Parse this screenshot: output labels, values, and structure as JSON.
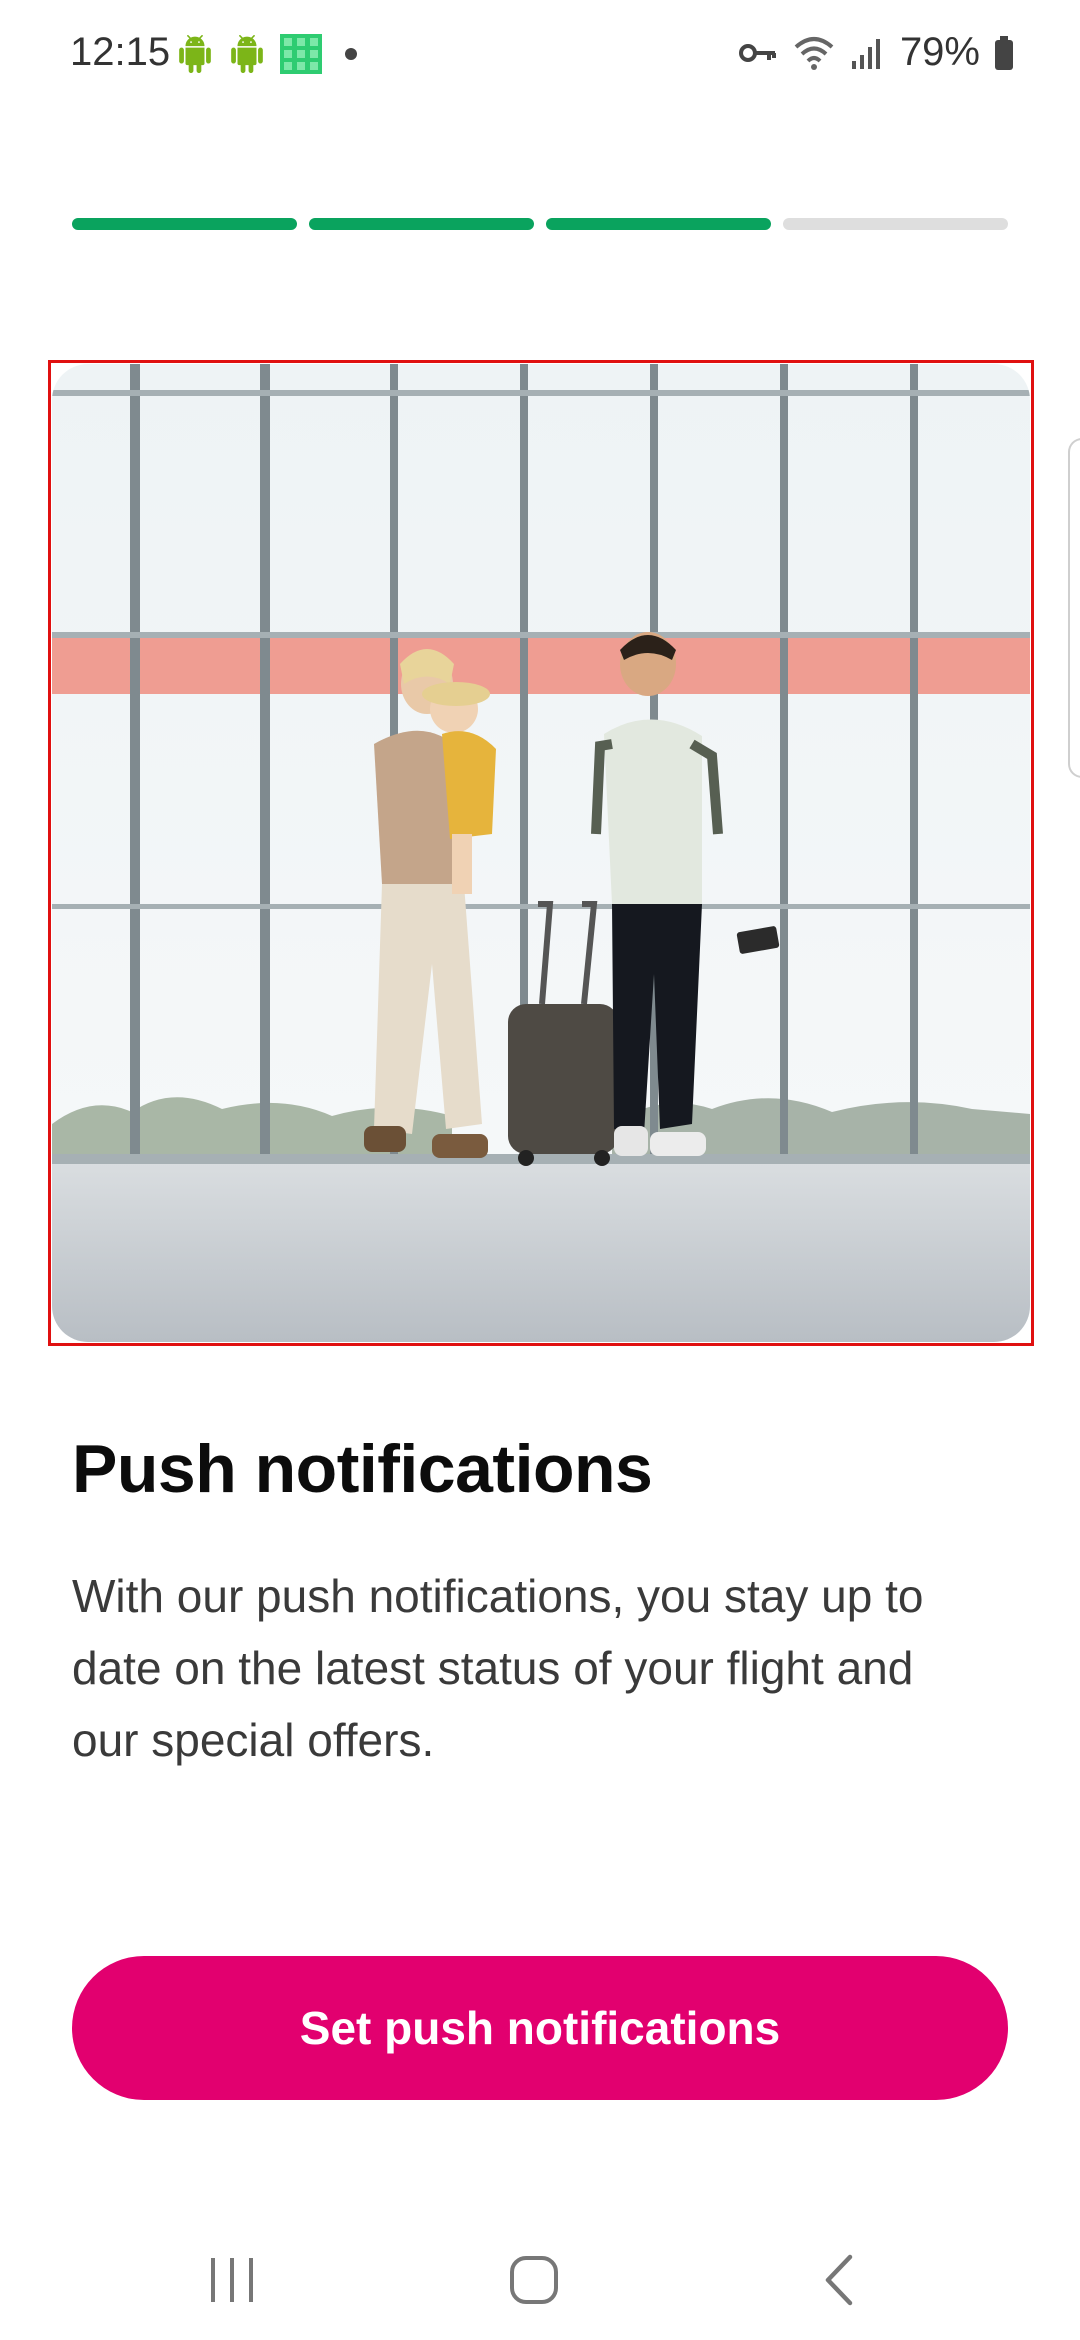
{
  "status_bar": {
    "time": "12:15",
    "battery": "79%",
    "icons": [
      "android-icon",
      "android-icon",
      "app-grid-icon",
      "dot-icon",
      "vpn-key-icon",
      "wifi-icon",
      "signal-icon",
      "battery-icon"
    ]
  },
  "onboarding": {
    "steps_total": 4,
    "steps_completed": 3,
    "progress_color": "#0aa35e",
    "progress_track_color": "#dedede"
  },
  "content": {
    "image": "family-walking-airport-photo",
    "title": "Push notifications",
    "description": "With our push notifications, you stay up to date on the latest status of your flight and our special offers."
  },
  "actions": {
    "primary_label": "Set push notifications",
    "primary_color": "#e2006f"
  },
  "nav_bar": {
    "icons": [
      "recent-apps-icon",
      "home-icon",
      "back-icon"
    ]
  }
}
